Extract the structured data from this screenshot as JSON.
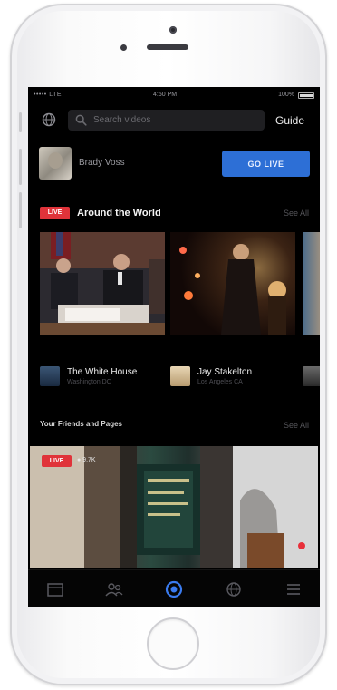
{
  "status_bar": {
    "carrier": "••••• LTE",
    "time": "4:50 PM",
    "battery_percent_text": "100%",
    "battery_level": 1.0
  },
  "header": {
    "search_placeholder": "Search videos",
    "guide_label": "Guide"
  },
  "profile": {
    "name": "Brady Voss",
    "go_live_label": "GO LIVE"
  },
  "around_world": {
    "badge": "LIVE",
    "title": "Around the World",
    "see_all": "See All",
    "cards": [
      {
        "name": "The White House",
        "location": "Washington DC"
      },
      {
        "name": "Jay Stakelton",
        "location": "Los Angeles CA"
      },
      {
        "name": "",
        "location": ""
      }
    ]
  },
  "friends_pages": {
    "title": "Your Friends and Pages",
    "see_all": "See All",
    "badge": "LIVE",
    "viewers": "● 9.7K"
  },
  "tabs": [
    {
      "icon": "news-feed-icon"
    },
    {
      "icon": "friends-icon"
    },
    {
      "icon": "live-video-icon"
    },
    {
      "icon": "globe-icon"
    },
    {
      "icon": "menu-icon"
    }
  ],
  "colors": {
    "accent": "#2d6fd6",
    "live": "#e0333a",
    "active_tab": "#3a7bef"
  }
}
